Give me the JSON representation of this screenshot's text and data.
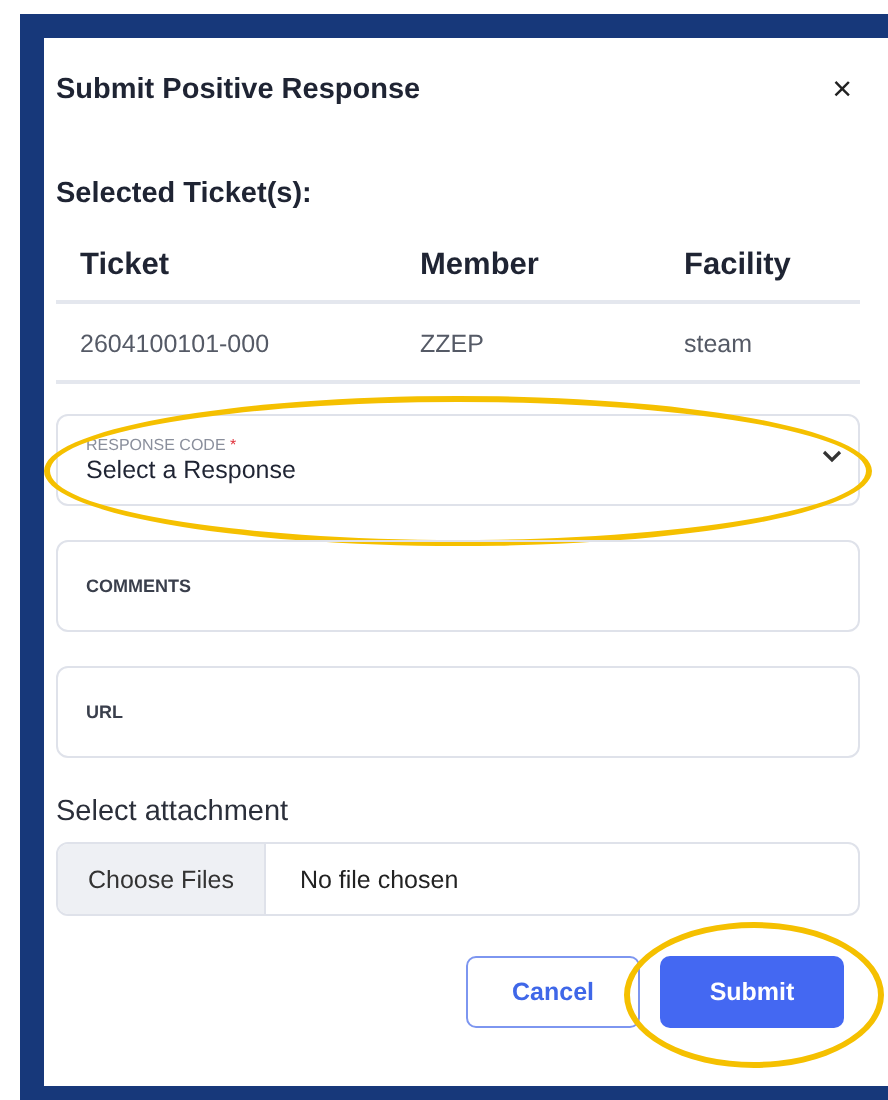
{
  "dialog": {
    "title": "Submit Positive Response",
    "close": "×"
  },
  "selected_heading": "Selected Ticket(s):",
  "table": {
    "columns": [
      "Ticket",
      "Member",
      "Facility"
    ],
    "rows": [
      [
        "2604100101-000",
        "ZZEP",
        "steam"
      ]
    ]
  },
  "fields": [
    {
      "kind": "select",
      "label": "RESPONSE CODE",
      "required_mark": "*",
      "value": "Select a Response",
      "highlighted": true
    },
    {
      "kind": "text",
      "label": "COMMENTS",
      "highlighted": false
    },
    {
      "kind": "text",
      "label": "URL",
      "highlighted": false
    }
  ],
  "attachment": {
    "label": "Select attachment",
    "button": "Choose Files",
    "status": "No file chosen"
  },
  "buttons": [
    {
      "kind": "secondary",
      "label": "Cancel",
      "highlighted": false
    },
    {
      "kind": "primary",
      "label": "Submit",
      "highlighted": true
    }
  ]
}
